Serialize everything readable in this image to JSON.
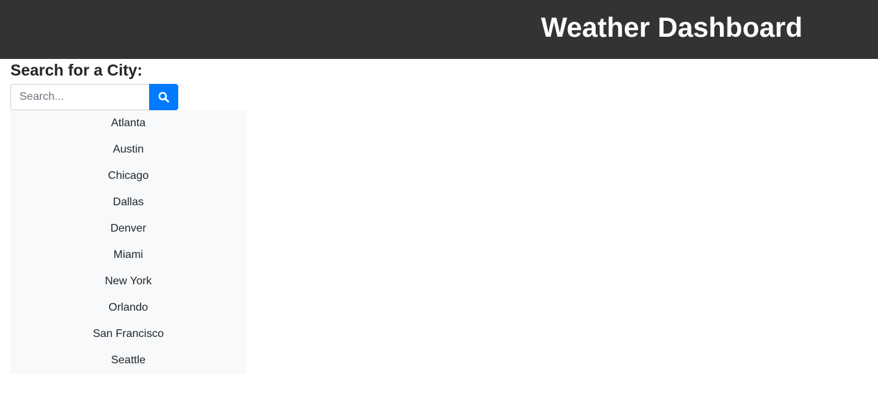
{
  "header": {
    "title": "Weather Dashboard"
  },
  "search": {
    "heading": "Search for a City:",
    "placeholder": "Search...",
    "value": "",
    "button_icon": "search-icon"
  },
  "cities": [
    "Atlanta",
    "Austin",
    "Chicago",
    "Dallas",
    "Denver",
    "Miami",
    "New York",
    "Orlando",
    "San Francisco",
    "Seattle"
  ],
  "colors": {
    "header_bg": "#333333",
    "accent": "#007bff",
    "list_bg": "#f8f9fa"
  }
}
